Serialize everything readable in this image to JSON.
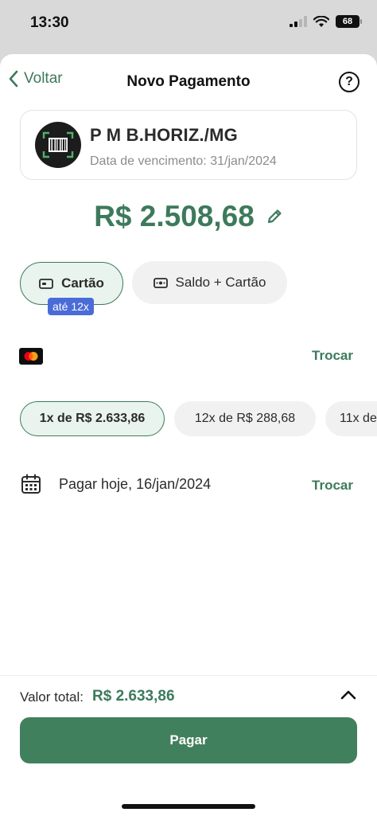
{
  "status": {
    "time": "13:30",
    "battery": "68"
  },
  "nav": {
    "back_label": "Voltar",
    "title": "Novo Pagamento",
    "help": "?"
  },
  "payee": {
    "name": "P M B.HORIZ./MG",
    "due_date": "Data de vencimento: 31/jan/2024"
  },
  "amount": {
    "value": "R$ 2.508,68"
  },
  "payment_methods": {
    "card_label": "Cartão",
    "card_badge": "até 12x",
    "balance_card_label": "Saldo + Cartão",
    "selected": "Cartão"
  },
  "card": {
    "swap_label": "Trocar"
  },
  "installments": [
    {
      "label": "1x de R$ 2.633,86",
      "selected": true
    },
    {
      "label": "12x de R$ 288,68",
      "selected": false
    },
    {
      "label": "11x de",
      "selected": false
    }
  ],
  "schedule": {
    "label": "Pagar hoje, 16/jan/2024",
    "swap_label": "Trocar"
  },
  "footer": {
    "total_label": "Valor total:",
    "total_value": "R$ 2.633,86",
    "pay_label": "Pagar"
  },
  "colors": {
    "brand_green": "#3d7a5b",
    "button_green": "#41805d",
    "badge_blue": "#4a6cd8"
  },
  "icons": [
    "chevron-left-icon",
    "help-icon",
    "barcode-icon",
    "edit-pencil-icon",
    "card-icon",
    "cash-icon",
    "mastercard-icon",
    "calendar-icon",
    "chevron-up-icon"
  ]
}
